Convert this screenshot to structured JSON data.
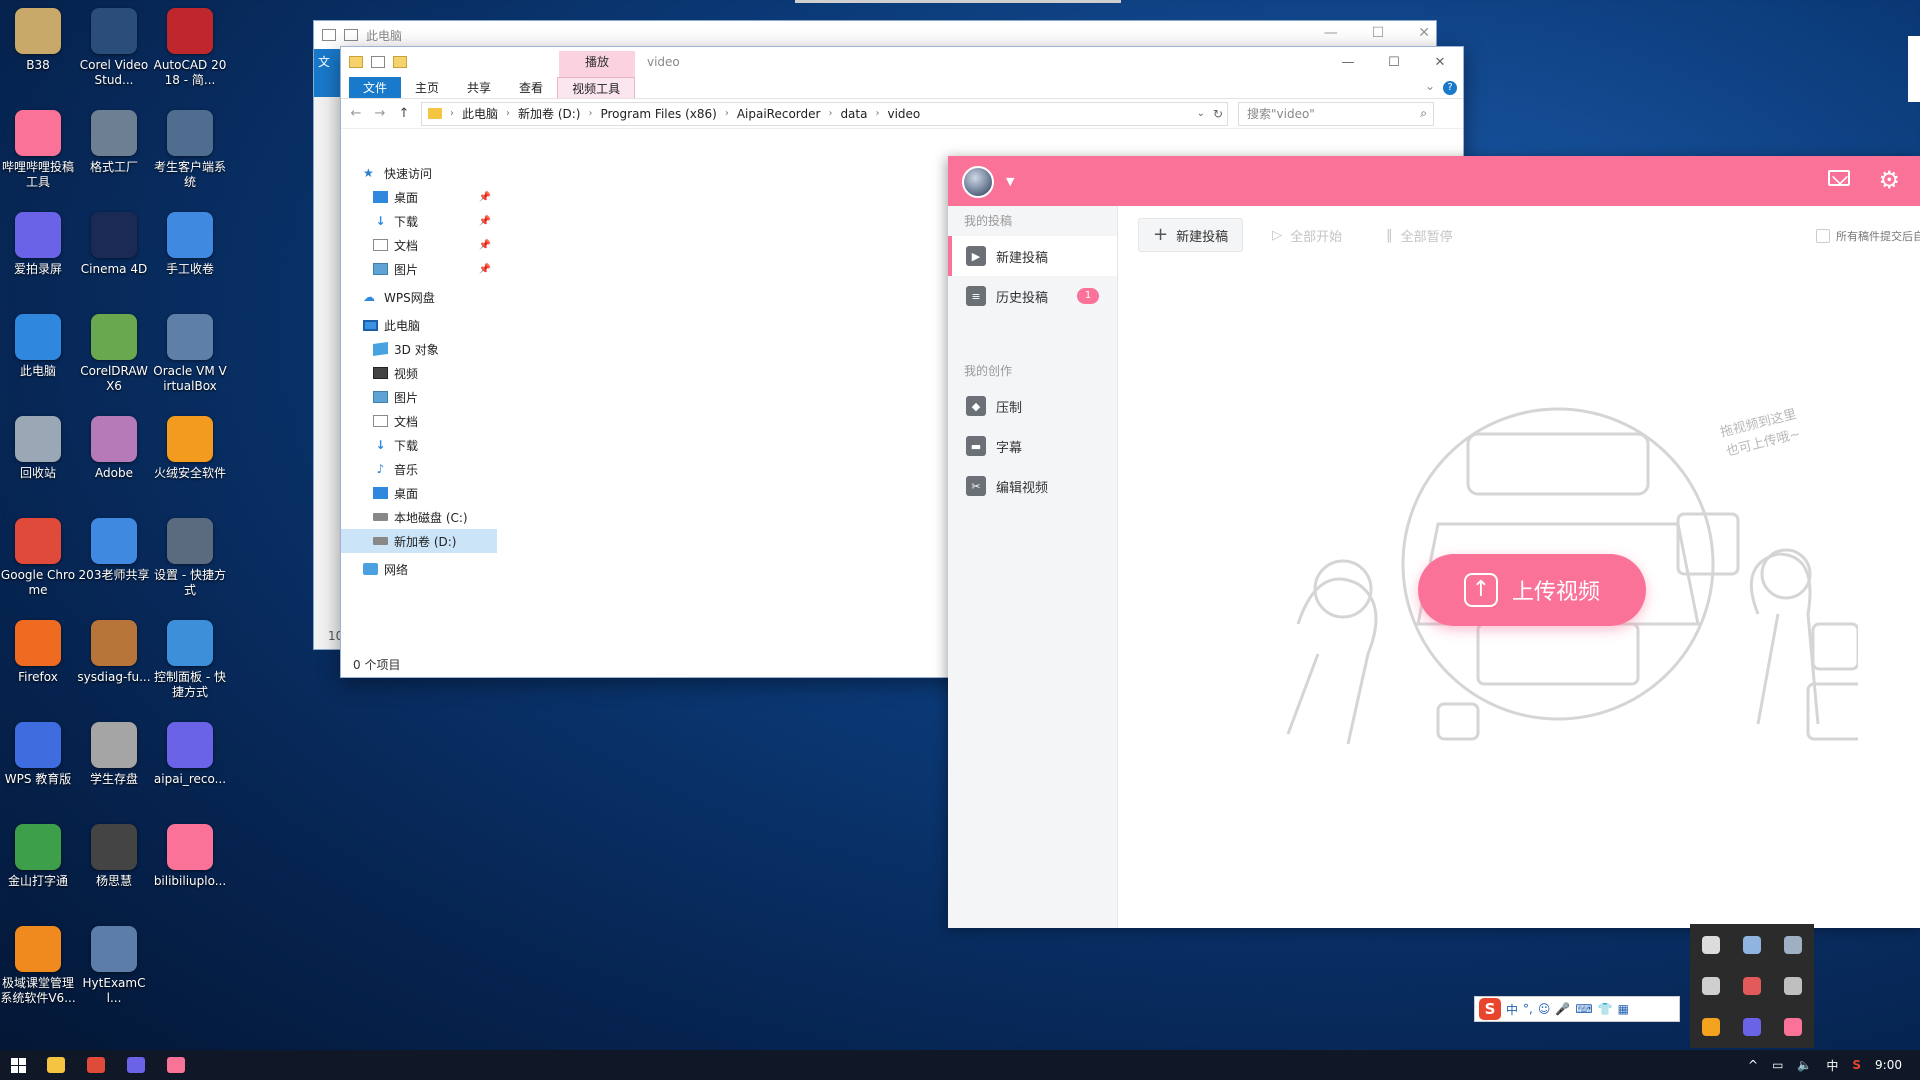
{
  "desktop": {
    "icons": [
      {
        "label": "B38",
        "color": "#c9a96a"
      },
      {
        "label": "Corel VideoStud...",
        "color": "#2a4d7a"
      },
      {
        "label": "AutoCAD 2018 - 简...",
        "color": "#c0272d"
      },
      {
        "label": "哔哩哔哩投稿工具",
        "color": "#fb7299"
      },
      {
        "label": "格式工厂",
        "color": "#6d7f93"
      },
      {
        "label": "考生客户端系统",
        "color": "#4f6e8f"
      },
      {
        "label": "爱拍录屏",
        "color": "#6a63e8"
      },
      {
        "label": "Cinema 4D",
        "color": "#1b2a55"
      },
      {
        "label": "手工收卷",
        "color": "#3f8ae0"
      },
      {
        "label": "此电脑",
        "color": "#2f88dd"
      },
      {
        "label": "CorelDRAW X6",
        "color": "#6aa84f"
      },
      {
        "label": "Oracle VM VirtualBox",
        "color": "#5d7fa8"
      },
      {
        "label": "回收站",
        "color": "#9aa7b5"
      },
      {
        "label": "Adobe",
        "color": "#b77ab8"
      },
      {
        "label": "火绒安全软件",
        "color": "#f29b1e"
      },
      {
        "label": "Google Chrome",
        "color": "#e04a3a"
      },
      {
        "label": "203老师共享",
        "color": "#3f8ae0"
      },
      {
        "label": "设置 - 快捷方式",
        "color": "#5a6b80"
      },
      {
        "label": "Firefox",
        "color": "#ef6b22"
      },
      {
        "label": "sysdiag-fu...",
        "color": "#b8753a"
      },
      {
        "label": "控制面板 - 快捷方式",
        "color": "#3c8fd8"
      },
      {
        "label": "WPS 教育版",
        "color": "#3f6de0"
      },
      {
        "label": "学生存盘",
        "color": "#a5a5a5"
      },
      {
        "label": "aipai_reco...",
        "color": "#6a63e8"
      },
      {
        "label": "金山打字通",
        "color": "#3d9f4a"
      },
      {
        "label": "杨思慧",
        "color": "#444444"
      },
      {
        "label": "bilibiliuplo...",
        "color": "#fb7299"
      },
      {
        "label": "极域课堂管理系统软件V6...",
        "color": "#f08a1e"
      },
      {
        "label": "HytExamCl...",
        "color": "#5b7da8"
      }
    ]
  },
  "bg_window": {
    "title": "此电脑",
    "strip_label": "文",
    "bottom_number": "10",
    "minimize": "—",
    "maximize": "☐",
    "close": "✕"
  },
  "explorer": {
    "context_tab": "播放",
    "title": "video",
    "controls": {
      "minimize": "—",
      "maximize": "☐",
      "close": "✕"
    },
    "ribbon": {
      "file": "文件",
      "home": "主页",
      "share": "共享",
      "view": "查看",
      "video_tools": "视频工具",
      "expand": "⌄",
      "help": "?"
    },
    "nav": {
      "back": "←",
      "forward": "→",
      "up": "↑",
      "dropdown": "⌄",
      "refresh": "↻"
    },
    "breadcrumb": [
      "此电脑",
      "新加卷 (D:)",
      "Program Files (x86)",
      "AipaiRecorder",
      "data",
      "video"
    ],
    "search_placeholder": "搜索\"video\"",
    "search_icon": "⌕",
    "tree": {
      "quick_access": "快速访问",
      "quick_items": [
        {
          "label": "桌面",
          "icon": "blue"
        },
        {
          "label": "下载",
          "icon": "dl"
        },
        {
          "label": "文档",
          "icon": "doc"
        },
        {
          "label": "图片",
          "icon": "pic"
        }
      ],
      "wps": "WPS网盘",
      "this_pc": "此电脑",
      "pc_items": [
        {
          "label": "3D 对象",
          "icon": "cube"
        },
        {
          "label": "视频",
          "icon": "vid"
        },
        {
          "label": "图片",
          "icon": "pic"
        },
        {
          "label": "文档",
          "icon": "doc"
        },
        {
          "label": "下载",
          "icon": "dl"
        },
        {
          "label": "音乐",
          "icon": "music"
        },
        {
          "label": "桌面",
          "icon": "blue"
        },
        {
          "label": "本地磁盘 (C:)",
          "icon": "drive"
        },
        {
          "label": "新加卷 (D:)",
          "icon": "drive",
          "selected": true
        }
      ],
      "network": "网络"
    },
    "status": "0 个项目"
  },
  "bili": {
    "colors": {
      "accent": "#fb7299"
    },
    "avatar_caret": "▼",
    "section_my_posts": "我的投稿",
    "new_post": "新建投稿",
    "history": "历史投稿",
    "history_badge": "1",
    "section_my_creation": "我的创作",
    "compress": "压制",
    "subtitle": "字幕",
    "edit_video": "编辑视频",
    "toolbar": {
      "new_post": "新建投稿",
      "start_all": "全部开始",
      "pause_all": "全部暂停",
      "auto_submit": "所有稿件提交后自"
    },
    "upload_video": "上传视频",
    "hint_line1": "拖视频到这里",
    "hint_line2": "也可上传哦~"
  },
  "ime": {
    "logo": "S",
    "items": [
      "中",
      "°,",
      "☺",
      "🎤",
      "⌨",
      "👕",
      "▦"
    ]
  },
  "taskbar": {
    "apps": [
      {
        "name": "explorer",
        "color": "#f5c542"
      },
      {
        "name": "chrome",
        "color": "#e04a3a"
      },
      {
        "name": "aipai",
        "color": "#6a63e8"
      },
      {
        "name": "bilibili",
        "color": "#fb7299"
      }
    ],
    "tray_caret": "^",
    "ime_indicator": "中",
    "time": "9:00"
  }
}
